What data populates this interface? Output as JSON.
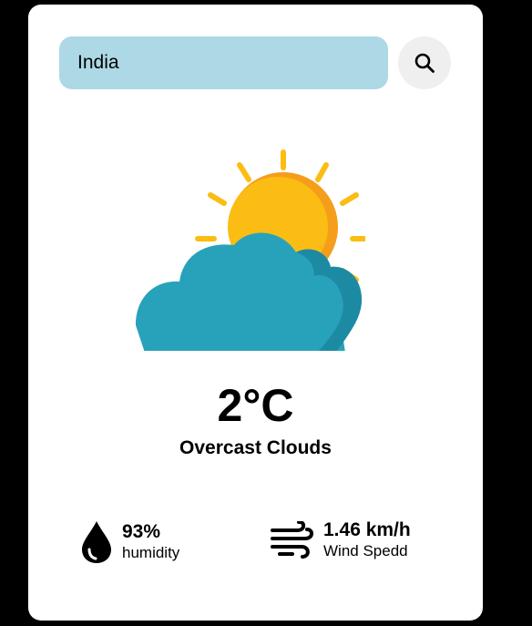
{
  "search": {
    "value": "India",
    "placeholder": "",
    "button_icon": "search-icon"
  },
  "weather": {
    "icon": "sun-behind-cloud-icon",
    "temperature": "2°C",
    "description": "Overcast Clouds"
  },
  "humidity": {
    "icon": "water-drop-icon",
    "value": "93%",
    "label": "humidity"
  },
  "wind": {
    "icon": "wind-icon",
    "value": "1.46 km/h",
    "label": "Wind Spedd"
  },
  "colors": {
    "background": "#000000",
    "card": "#ffffff",
    "search_field": "#add8e6",
    "search_button": "#efefef",
    "sun": "#fbbd13",
    "cloud": "#28a2bb"
  }
}
